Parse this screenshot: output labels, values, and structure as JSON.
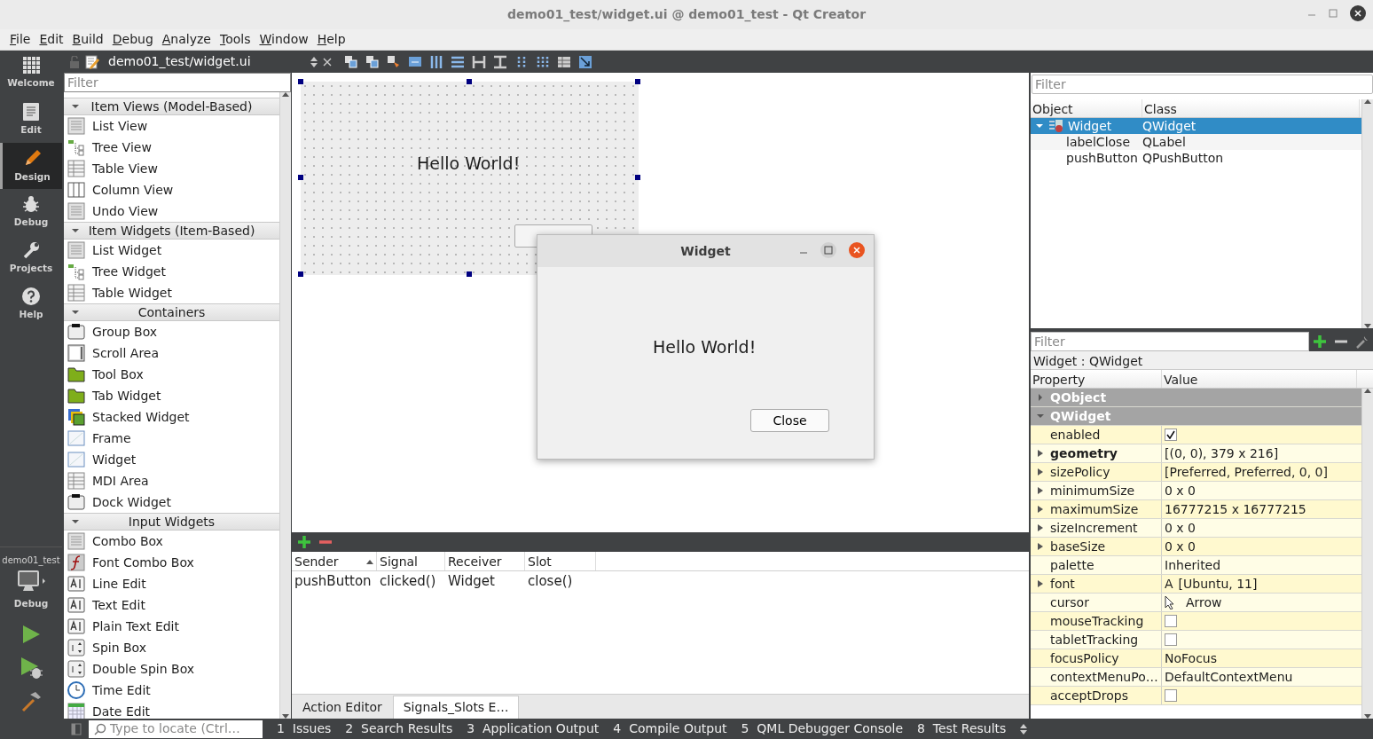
{
  "window": {
    "title": "demo01_test/widget.ui @ demo01_test - Qt Creator"
  },
  "menu": [
    {
      "label": "File"
    },
    {
      "label": "Edit"
    },
    {
      "label": "Build"
    },
    {
      "label": "Debug"
    },
    {
      "label": "Analyze"
    },
    {
      "label": "Tools"
    },
    {
      "label": "Window"
    },
    {
      "label": "Help"
    }
  ],
  "mode_bar": {
    "modes": [
      {
        "label": "Welcome",
        "kind": "grid",
        "selected": false
      },
      {
        "label": "Edit",
        "kind": "doc",
        "selected": false
      },
      {
        "label": "Design",
        "kind": "pencil",
        "selected": true
      },
      {
        "label": "Debug",
        "kind": "bug",
        "selected": false
      },
      {
        "label": "Projects",
        "kind": "wrench",
        "selected": false
      },
      {
        "label": "Help",
        "kind": "help",
        "selected": false
      }
    ],
    "target": {
      "project": "demo01_test",
      "config": "Debug"
    }
  },
  "editor_toolbar": {
    "file": "demo01_test/widget.ui"
  },
  "widget_box": {
    "filter_placeholder": "Filter",
    "groups": [
      {
        "label": "Item Views (Model-Based)",
        "expanded": true,
        "items": [
          {
            "label": "List View",
            "kind": "list"
          },
          {
            "label": "Tree View",
            "kind": "tree"
          },
          {
            "label": "Table View",
            "kind": "table"
          },
          {
            "label": "Column View",
            "kind": "columns"
          },
          {
            "label": "Undo View",
            "kind": "list"
          }
        ]
      },
      {
        "label": "Item Widgets (Item-Based)",
        "expanded": true,
        "items": [
          {
            "label": "List Widget",
            "kind": "list"
          },
          {
            "label": "Tree Widget",
            "kind": "tree"
          },
          {
            "label": "Table Widget",
            "kind": "table"
          }
        ]
      },
      {
        "label": "Containers",
        "expanded": true,
        "items": [
          {
            "label": "Group Box",
            "kind": "box"
          },
          {
            "label": "Scroll Area",
            "kind": "scroll"
          },
          {
            "label": "Tool Box",
            "kind": "folder"
          },
          {
            "label": "Tab Widget",
            "kind": "folder"
          },
          {
            "label": "Stacked Widget",
            "kind": "stack"
          },
          {
            "label": "Frame",
            "kind": "frame"
          },
          {
            "label": "Widget",
            "kind": "frame"
          },
          {
            "label": "MDI Area",
            "kind": "table"
          },
          {
            "label": "Dock Widget",
            "kind": "box"
          }
        ]
      },
      {
        "label": "Input Widgets",
        "expanded": true,
        "items": [
          {
            "label": "Combo Box",
            "kind": "list"
          },
          {
            "label": "Font Combo Box",
            "kind": "font"
          },
          {
            "label": "Line Edit",
            "kind": "field"
          },
          {
            "label": "Text Edit",
            "kind": "field"
          },
          {
            "label": "Plain Text Edit",
            "kind": "field"
          },
          {
            "label": "Spin Box",
            "kind": "spin"
          },
          {
            "label": "Double Spin Box",
            "kind": "spin"
          },
          {
            "label": "Time Edit",
            "kind": "clock"
          },
          {
            "label": "Date Edit",
            "kind": "calendar"
          }
        ]
      }
    ]
  },
  "form": {
    "label": "Hello World!"
  },
  "preview": {
    "title": "Widget",
    "label": "Hello World!",
    "button": "Close"
  },
  "signals_slots": {
    "columns": [
      {
        "label": "Sender",
        "sorted": true
      },
      {
        "label": "Signal",
        "sorted": false
      },
      {
        "label": "Receiver",
        "sorted": false
      },
      {
        "label": "Slot",
        "sorted": false
      }
    ],
    "rows": [
      [
        "pushButton",
        "clicked()",
        "Widget",
        "close()"
      ]
    ],
    "tabs": [
      {
        "label": "Action Editor",
        "selected": false
      },
      {
        "label": "Signals_Slots E…",
        "selected": true
      }
    ]
  },
  "object_inspector": {
    "filter_placeholder": "Filter",
    "columns": [
      "Object",
      "Class"
    ],
    "tree": [
      {
        "object": "Widget",
        "class": "QWidget",
        "selected": true,
        "expanded": true,
        "children": [
          {
            "object": "labelClose",
            "class": "QLabel",
            "selected": false
          },
          {
            "object": "pushButton",
            "class": "QPushButton",
            "selected": false
          }
        ]
      }
    ]
  },
  "property_editor": {
    "filter_placeholder": "Filter",
    "heading": "Widget : QWidget",
    "columns": [
      "Property",
      "Value"
    ],
    "rows": [
      {
        "kind": "group",
        "name": "QObject",
        "expanded": false
      },
      {
        "kind": "group",
        "name": "QWidget",
        "expanded": true
      },
      {
        "kind": "check",
        "name": "enabled",
        "checked": true,
        "expandable": false,
        "modified": false
      },
      {
        "kind": "text",
        "name": "geometry",
        "value": "[(0, 0), 379 x 216]",
        "expandable": true,
        "modified": true
      },
      {
        "kind": "text",
        "name": "sizePolicy",
        "value": "[Preferred, Preferred, 0, 0]",
        "expandable": true,
        "modified": false
      },
      {
        "kind": "text",
        "name": "minimumSize",
        "value": "0 x 0",
        "expandable": true,
        "modified": false
      },
      {
        "kind": "text",
        "name": "maximumSize",
        "value": "16777215 x 16777215",
        "expandable": true,
        "modified": false
      },
      {
        "kind": "text",
        "name": "sizeIncrement",
        "value": "0 x 0",
        "expandable": true,
        "modified": false
      },
      {
        "kind": "text",
        "name": "baseSize",
        "value": "0 x 0",
        "expandable": true,
        "modified": false
      },
      {
        "kind": "text",
        "name": "palette",
        "value": "Inherited",
        "expandable": false,
        "modified": false
      },
      {
        "kind": "font",
        "name": "font",
        "glyph": "A",
        "value": "[Ubuntu, 11]",
        "expandable": true,
        "modified": false
      },
      {
        "kind": "cursor",
        "name": "cursor",
        "value": "Arrow",
        "expandable": false,
        "modified": false
      },
      {
        "kind": "check",
        "name": "mouseTracking",
        "checked": false,
        "expandable": false,
        "modified": false
      },
      {
        "kind": "check",
        "name": "tabletTracking",
        "checked": false,
        "expandable": false,
        "modified": false
      },
      {
        "kind": "text",
        "name": "focusPolicy",
        "value": "NoFocus",
        "expandable": false,
        "modified": false
      },
      {
        "kind": "text",
        "name": "contextMenuPo…",
        "value": "DefaultContextMenu",
        "expandable": false,
        "modified": false
      },
      {
        "kind": "check",
        "name": "acceptDrops",
        "checked": false,
        "expandable": false,
        "modified": false
      }
    ]
  },
  "status_bar": {
    "locator_placeholder": "Type to locate (Ctrl…",
    "panes": [
      {
        "number": "1",
        "label": "Issues"
      },
      {
        "number": "2",
        "label": "Search Results"
      },
      {
        "number": "3",
        "label": "Application Output"
      },
      {
        "number": "4",
        "label": "Compile Output"
      },
      {
        "number": "5",
        "label": "QML Debugger Console"
      },
      {
        "number": "8",
        "label": "Test Results"
      }
    ]
  }
}
